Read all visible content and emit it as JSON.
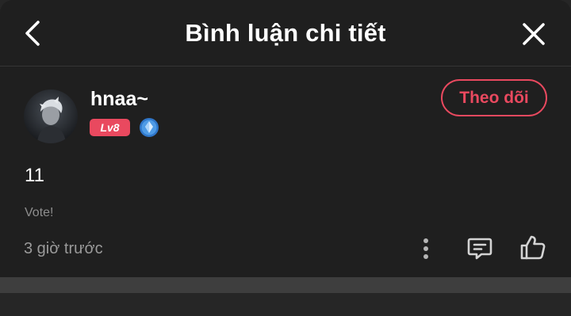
{
  "header": {
    "title": "Bình luận chi tiết",
    "back_icon": "chevron-left-icon",
    "close_icon": "close-icon"
  },
  "user": {
    "username": "hnaa~",
    "level": "Lv8",
    "rank_icon": "diamond-rank-icon",
    "avatar": "avatar"
  },
  "follow_button": {
    "label": "Theo dõi"
  },
  "comment": {
    "text": "11",
    "vote_label": "Vote!",
    "timestamp": "3 giờ trước"
  },
  "actions": {
    "more_icon": "more-vertical-icon",
    "reply_icon": "comment-icon",
    "like_icon": "thumbs-up-icon"
  },
  "colors": {
    "background": "#1f1f1f",
    "accent": "#e9495f",
    "muted_text": "#9a9a9a"
  }
}
